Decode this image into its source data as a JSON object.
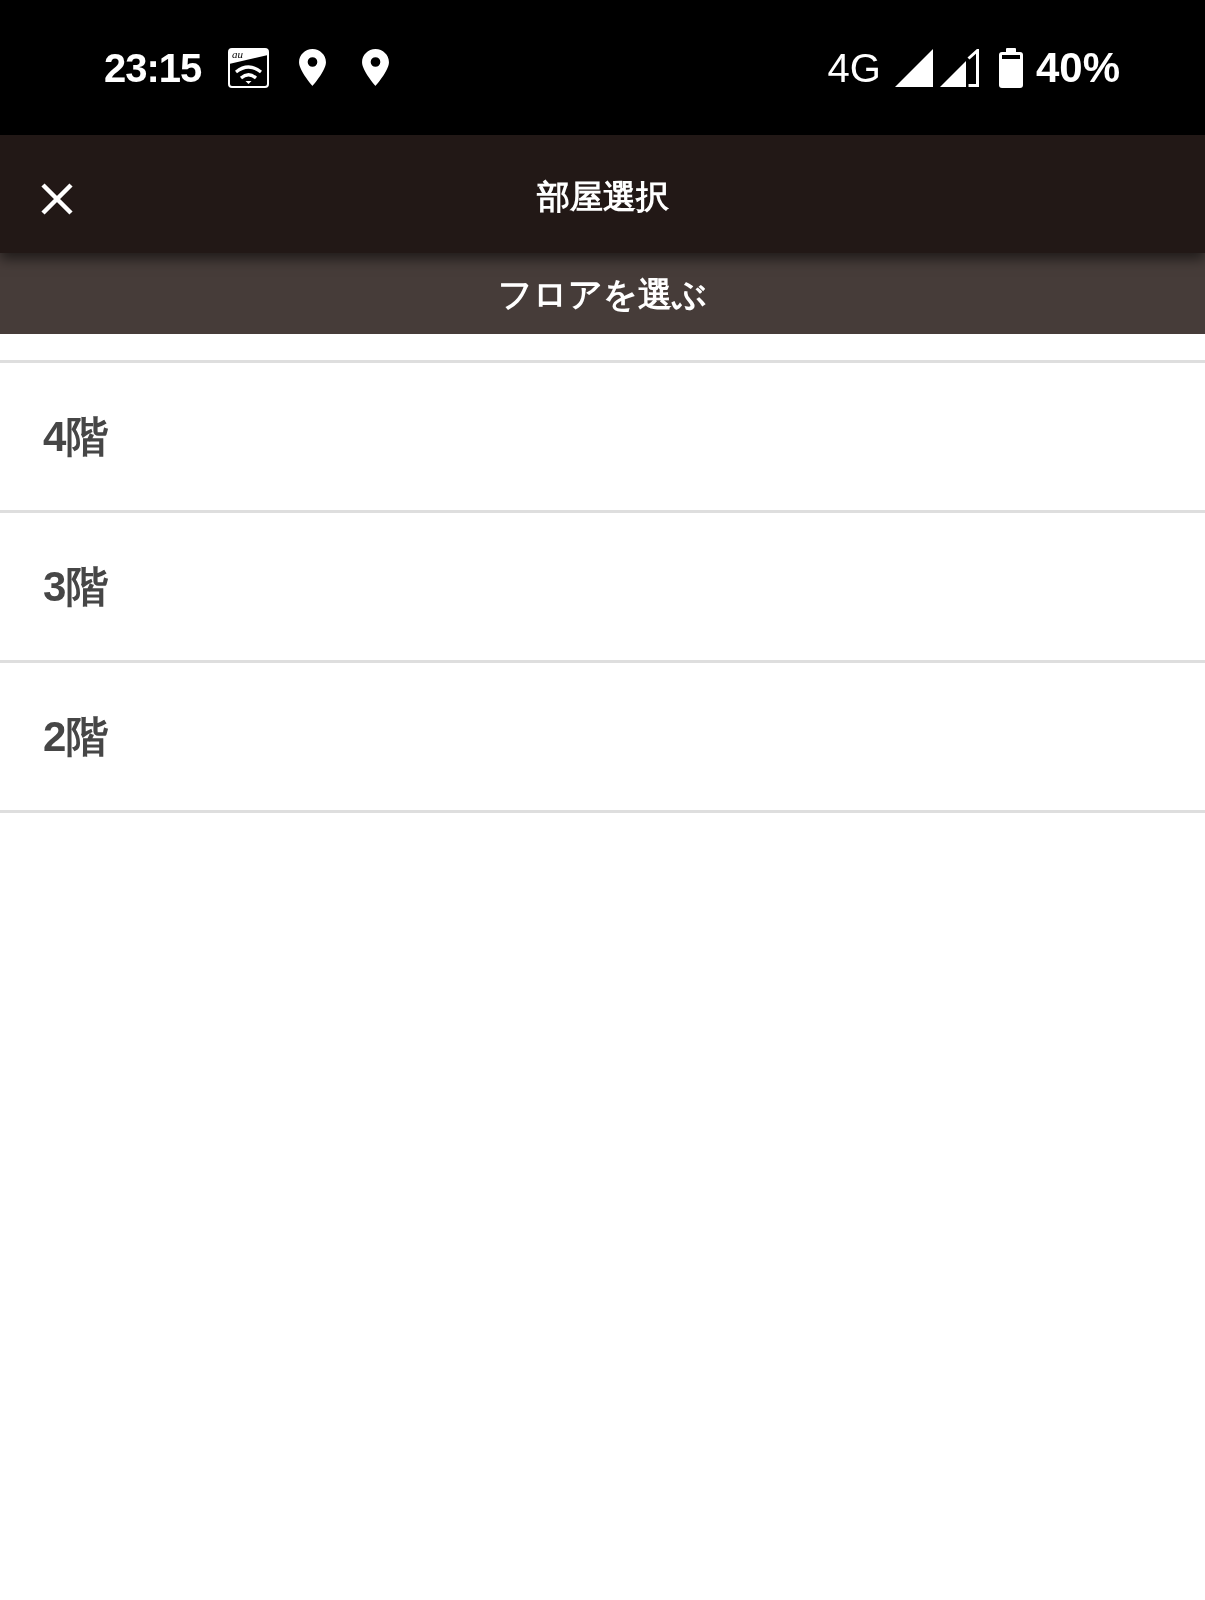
{
  "status_bar": {
    "time": "23:15",
    "carrier_logo": "au",
    "network": "4G",
    "battery": "40%"
  },
  "header": {
    "title": "部屋選択"
  },
  "subheader": {
    "title": "フロアを選ぶ"
  },
  "floors": [
    {
      "label": "4階"
    },
    {
      "label": "3階"
    },
    {
      "label": "2階"
    }
  ]
}
